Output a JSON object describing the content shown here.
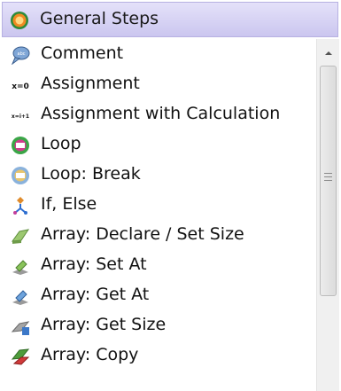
{
  "header": {
    "title": "General Steps",
    "icon": "green-circle-icon"
  },
  "items": [
    {
      "label": "Comment",
      "icon": "comment-icon"
    },
    {
      "label": "Assignment",
      "icon": "assignment-icon",
      "icon_text": "x=0"
    },
    {
      "label": "Assignment with Calculation",
      "icon": "calculation-icon",
      "icon_text": "x=i+1"
    },
    {
      "label": "Loop",
      "icon": "loop-icon"
    },
    {
      "label": "Loop: Break",
      "icon": "loop-break-icon"
    },
    {
      "label": "If, Else",
      "icon": "if-else-icon"
    },
    {
      "label": "Array: Declare / Set Size",
      "icon": "array-declare-icon"
    },
    {
      "label": "Array: Set At",
      "icon": "array-set-at-icon"
    },
    {
      "label": "Array: Get At",
      "icon": "array-get-at-icon"
    },
    {
      "label": "Array: Get Size",
      "icon": "array-get-size-icon"
    },
    {
      "label": "Array: Copy",
      "icon": "array-copy-icon"
    }
  ]
}
